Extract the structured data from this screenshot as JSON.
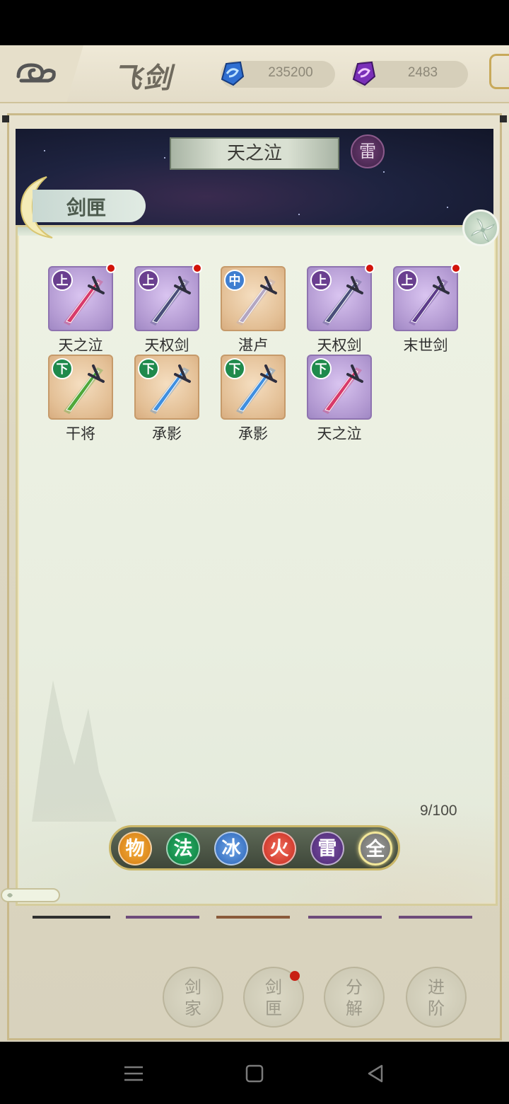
{
  "header": {
    "title": "飞剑",
    "currency1": "235200",
    "currency2": "2483"
  },
  "scene": {
    "sword_name": "天之泣",
    "element": "雷"
  },
  "popup": {
    "tab_label": "剑匣",
    "capacity": "9/100",
    "items": [
      {
        "name": "天之泣",
        "grade": "上",
        "rarity": "purple",
        "new": true,
        "sword_color": "#d83a6a"
      },
      {
        "name": "天权剑",
        "grade": "上",
        "rarity": "purple",
        "new": true,
        "sword_color": "#4a4f7a"
      },
      {
        "name": "湛卢",
        "grade": "中",
        "rarity": "orange",
        "new": false,
        "sword_color": "#b3a6c2"
      },
      {
        "name": "天权剑",
        "grade": "上",
        "rarity": "purple",
        "new": true,
        "sword_color": "#4a4f7a"
      },
      {
        "name": "末世剑",
        "grade": "上",
        "rarity": "purple",
        "new": true,
        "sword_color": "#5d3c8a"
      },
      {
        "name": "干将",
        "grade": "下",
        "rarity": "orange",
        "new": false,
        "sword_color": "#4fa83a"
      },
      {
        "name": "承影",
        "grade": "下",
        "rarity": "orange",
        "new": false,
        "sword_color": "#3f8fe0"
      },
      {
        "name": "承影",
        "grade": "下",
        "rarity": "orange",
        "new": false,
        "sword_color": "#3f8fe0"
      },
      {
        "name": "天之泣",
        "grade": "下",
        "rarity": "purple",
        "new": false,
        "sword_color": "#d83a6a"
      }
    ],
    "filters": [
      "物",
      "法",
      "冰",
      "火",
      "雷",
      "全"
    ]
  },
  "actions": {
    "a1": "剑家",
    "a2": "剑匣",
    "a3": "分解",
    "a4": "进阶"
  },
  "colors": {
    "grade_up": "#6a3f8f",
    "grade_mid": "#3f7ed0",
    "grade_low": "#1f8a4c",
    "new_dot": "#d2140a"
  }
}
